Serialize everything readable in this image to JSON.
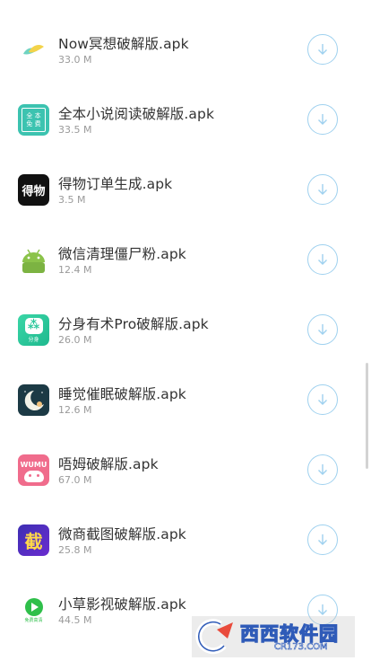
{
  "apps": [
    {
      "name": "Now冥想破解版.apk",
      "size": "33.0 M",
      "icon": "now-meditation-icon"
    },
    {
      "name": "全本小说阅读破解版.apk",
      "size": "33.5 M",
      "icon": "novel-reader-icon",
      "icon_text": [
        "全 本",
        "免 费"
      ]
    },
    {
      "name": "得物订单生成.apk",
      "size": "3.5 M",
      "icon": "dewu-icon",
      "icon_text": [
        "得物"
      ]
    },
    {
      "name": "微信清理僵尸粉.apk",
      "size": "12.4 M",
      "icon": "android-robot-icon"
    },
    {
      "name": "分身有术Pro破解版.apk",
      "size": "26.0 M",
      "icon": "clone-app-icon",
      "icon_text": [
        "分身"
      ]
    },
    {
      "name": "睡觉催眠破解版.apk",
      "size": "12.6 M",
      "icon": "sleep-moon-icon"
    },
    {
      "name": "唔姆破解版.apk",
      "size": "67.0 M",
      "icon": "wumu-icon",
      "icon_text": [
        "WUMU"
      ]
    },
    {
      "name": "微商截图破解版.apk",
      "size": "25.8 M",
      "icon": "screenshot-tool-icon",
      "icon_text": [
        "截"
      ]
    },
    {
      "name": "小草影视破解版.apk",
      "size": "44.5 M",
      "icon": "grass-video-icon",
      "icon_text": [
        "免费高清"
      ]
    }
  ],
  "watermark": {
    "text": "西西软件园",
    "sub": "CR173.COM"
  },
  "colors": {
    "download_ring": "#9fd1ef",
    "title": "#333333",
    "size": "#9a9a9a"
  }
}
